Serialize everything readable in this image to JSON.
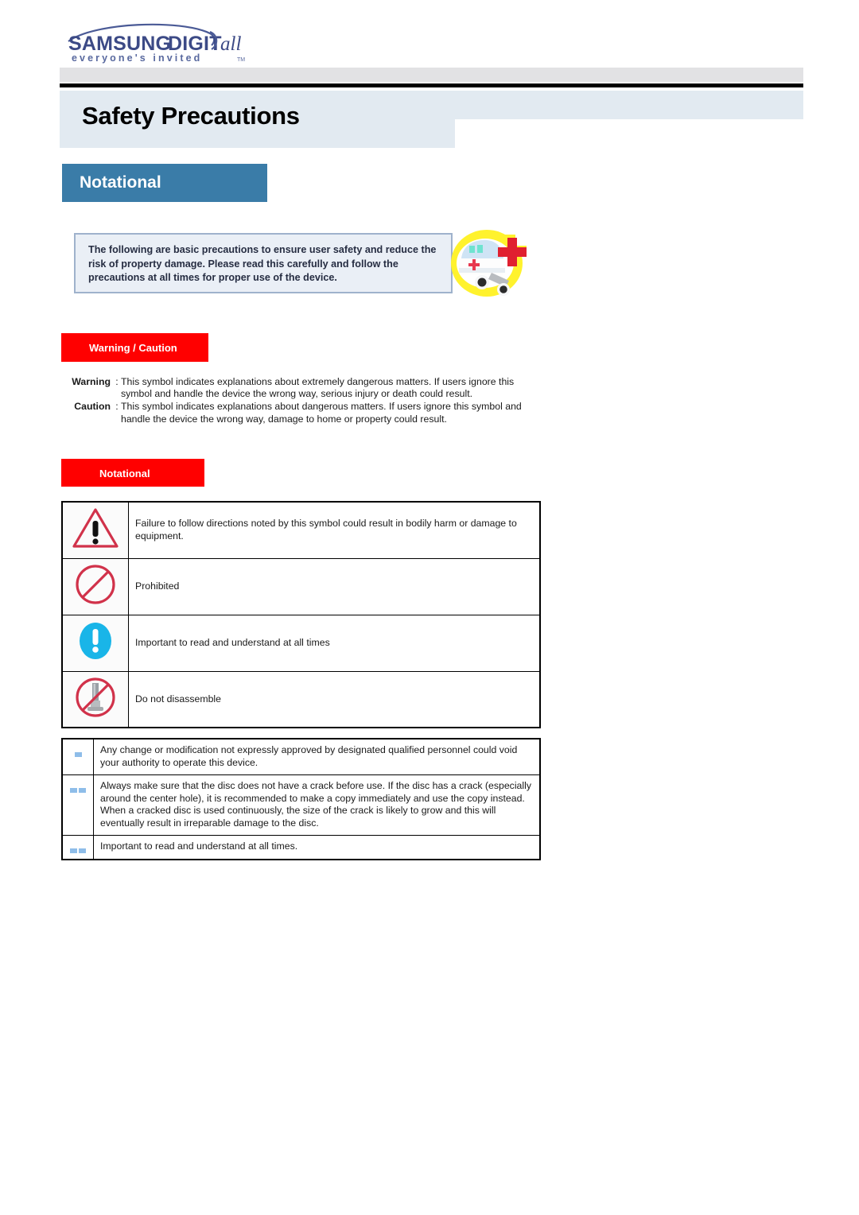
{
  "brand": {
    "logo_primary": "SAMSUNG DIGITall",
    "logo_tagline": "everyone's invited",
    "logo_tm": "TM"
  },
  "header": {
    "title": "Safety Precautions"
  },
  "section": {
    "tab_label": "Notational"
  },
  "intro": {
    "banner_text": "The following are basic precautions to ensure user safety and reduce the risk of property damage.  Please read this carefully and follow the precautions at all times for proper use of the device.",
    "illustration": "ambulance-icon"
  },
  "warning_caution": {
    "label": "Warning / Caution",
    "definitions": [
      {
        "term": "Warning",
        "colon": ":",
        "body": "This symbol indicates explanations about extremely dangerous matters. If users ignore this symbol and handle the device the wrong way, serious injury or death could result."
      },
      {
        "term": "Caution",
        "colon": ":",
        "body": "This symbol indicates explanations about dangerous matters. If users ignore this symbol and handle the device the wrong way, damage to home or property could result."
      }
    ]
  },
  "notational": {
    "label": "Notational",
    "symbols": [
      {
        "icon": "warning-triangle-icon",
        "description": "Failure to follow directions noted by this symbol could result in bodily harm or damage to equipment."
      },
      {
        "icon": "prohibited-icon",
        "description": "Prohibited"
      },
      {
        "icon": "important-exclamation-icon",
        "description": "Important to read and understand at all times"
      },
      {
        "icon": "do-not-disassemble-icon",
        "description": "Do not disassemble"
      }
    ]
  },
  "notes": [
    {
      "bullets": 1,
      "text": "Any change or modification not expressly approved by designated qualified personnel could void your authority to operate this device."
    },
    {
      "bullets": 2,
      "text": "Always make sure that the disc does not have a crack before use. If the disc has a crack (especially around the center hole), it is recommended to make a copy immediately and use the copy instead. When a cracked disc is used continuously, the size of the crack is likely to grow and this will eventually result in irreparable damage to the disc."
    },
    {
      "bullets": 2,
      "text": "Important to read and understand at all times."
    }
  ],
  "colors": {
    "brand_blue": "#3a7ca8",
    "alert_red": "#ff0000",
    "title_band": "#e2eaf1",
    "banner_bg": "#eaeff6",
    "bullet_blue": "#8ebde9",
    "important_cyan": "#19b5e8",
    "prohibit_red": "#d42a44"
  }
}
